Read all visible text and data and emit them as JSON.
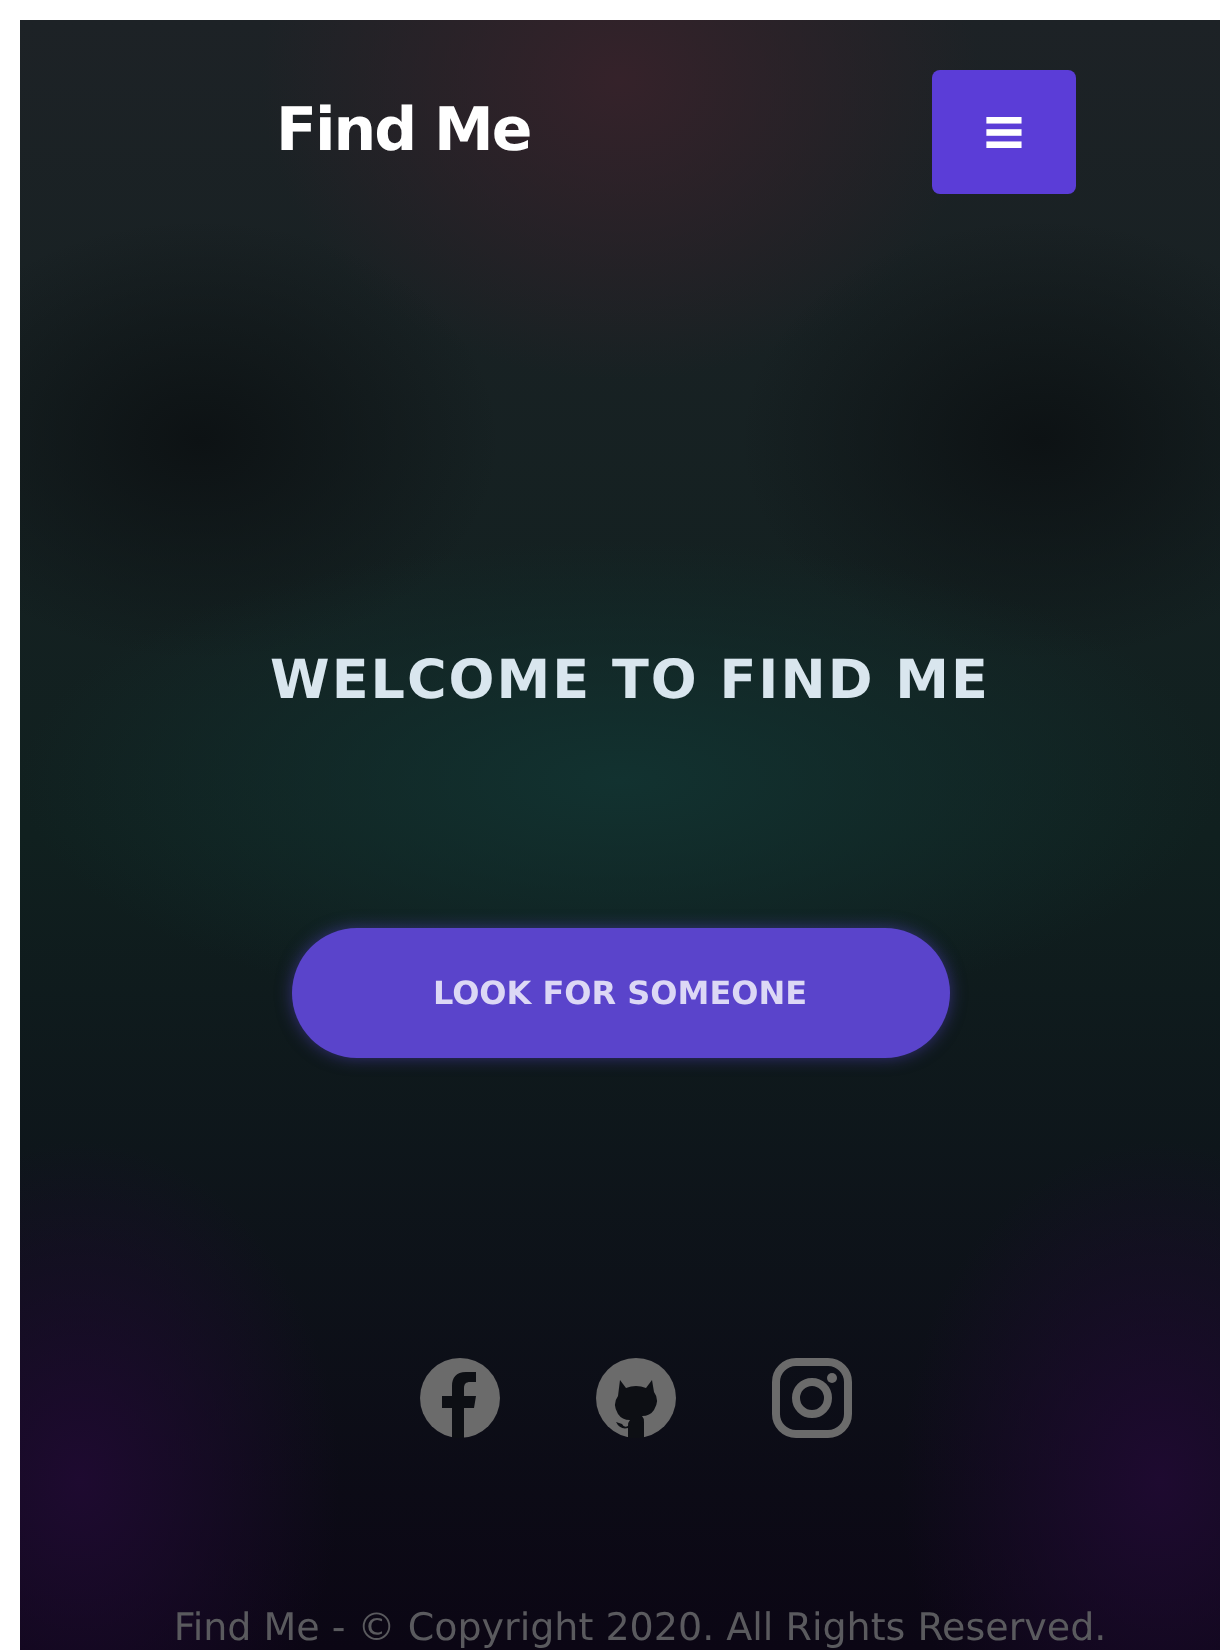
{
  "header": {
    "brand": "Find Me",
    "menu_button": "≡"
  },
  "hero": {
    "heading": "WELCOME TO FIND ME",
    "button": "LOOK FOR SOMEONE"
  },
  "social_links": [
    {
      "kind": "facebook"
    },
    {
      "kind": "github"
    },
    {
      "kind": "instagram"
    }
  ],
  "footer": {
    "text": "Find Me - © Copyright 2020. All Rights Reserved."
  }
}
